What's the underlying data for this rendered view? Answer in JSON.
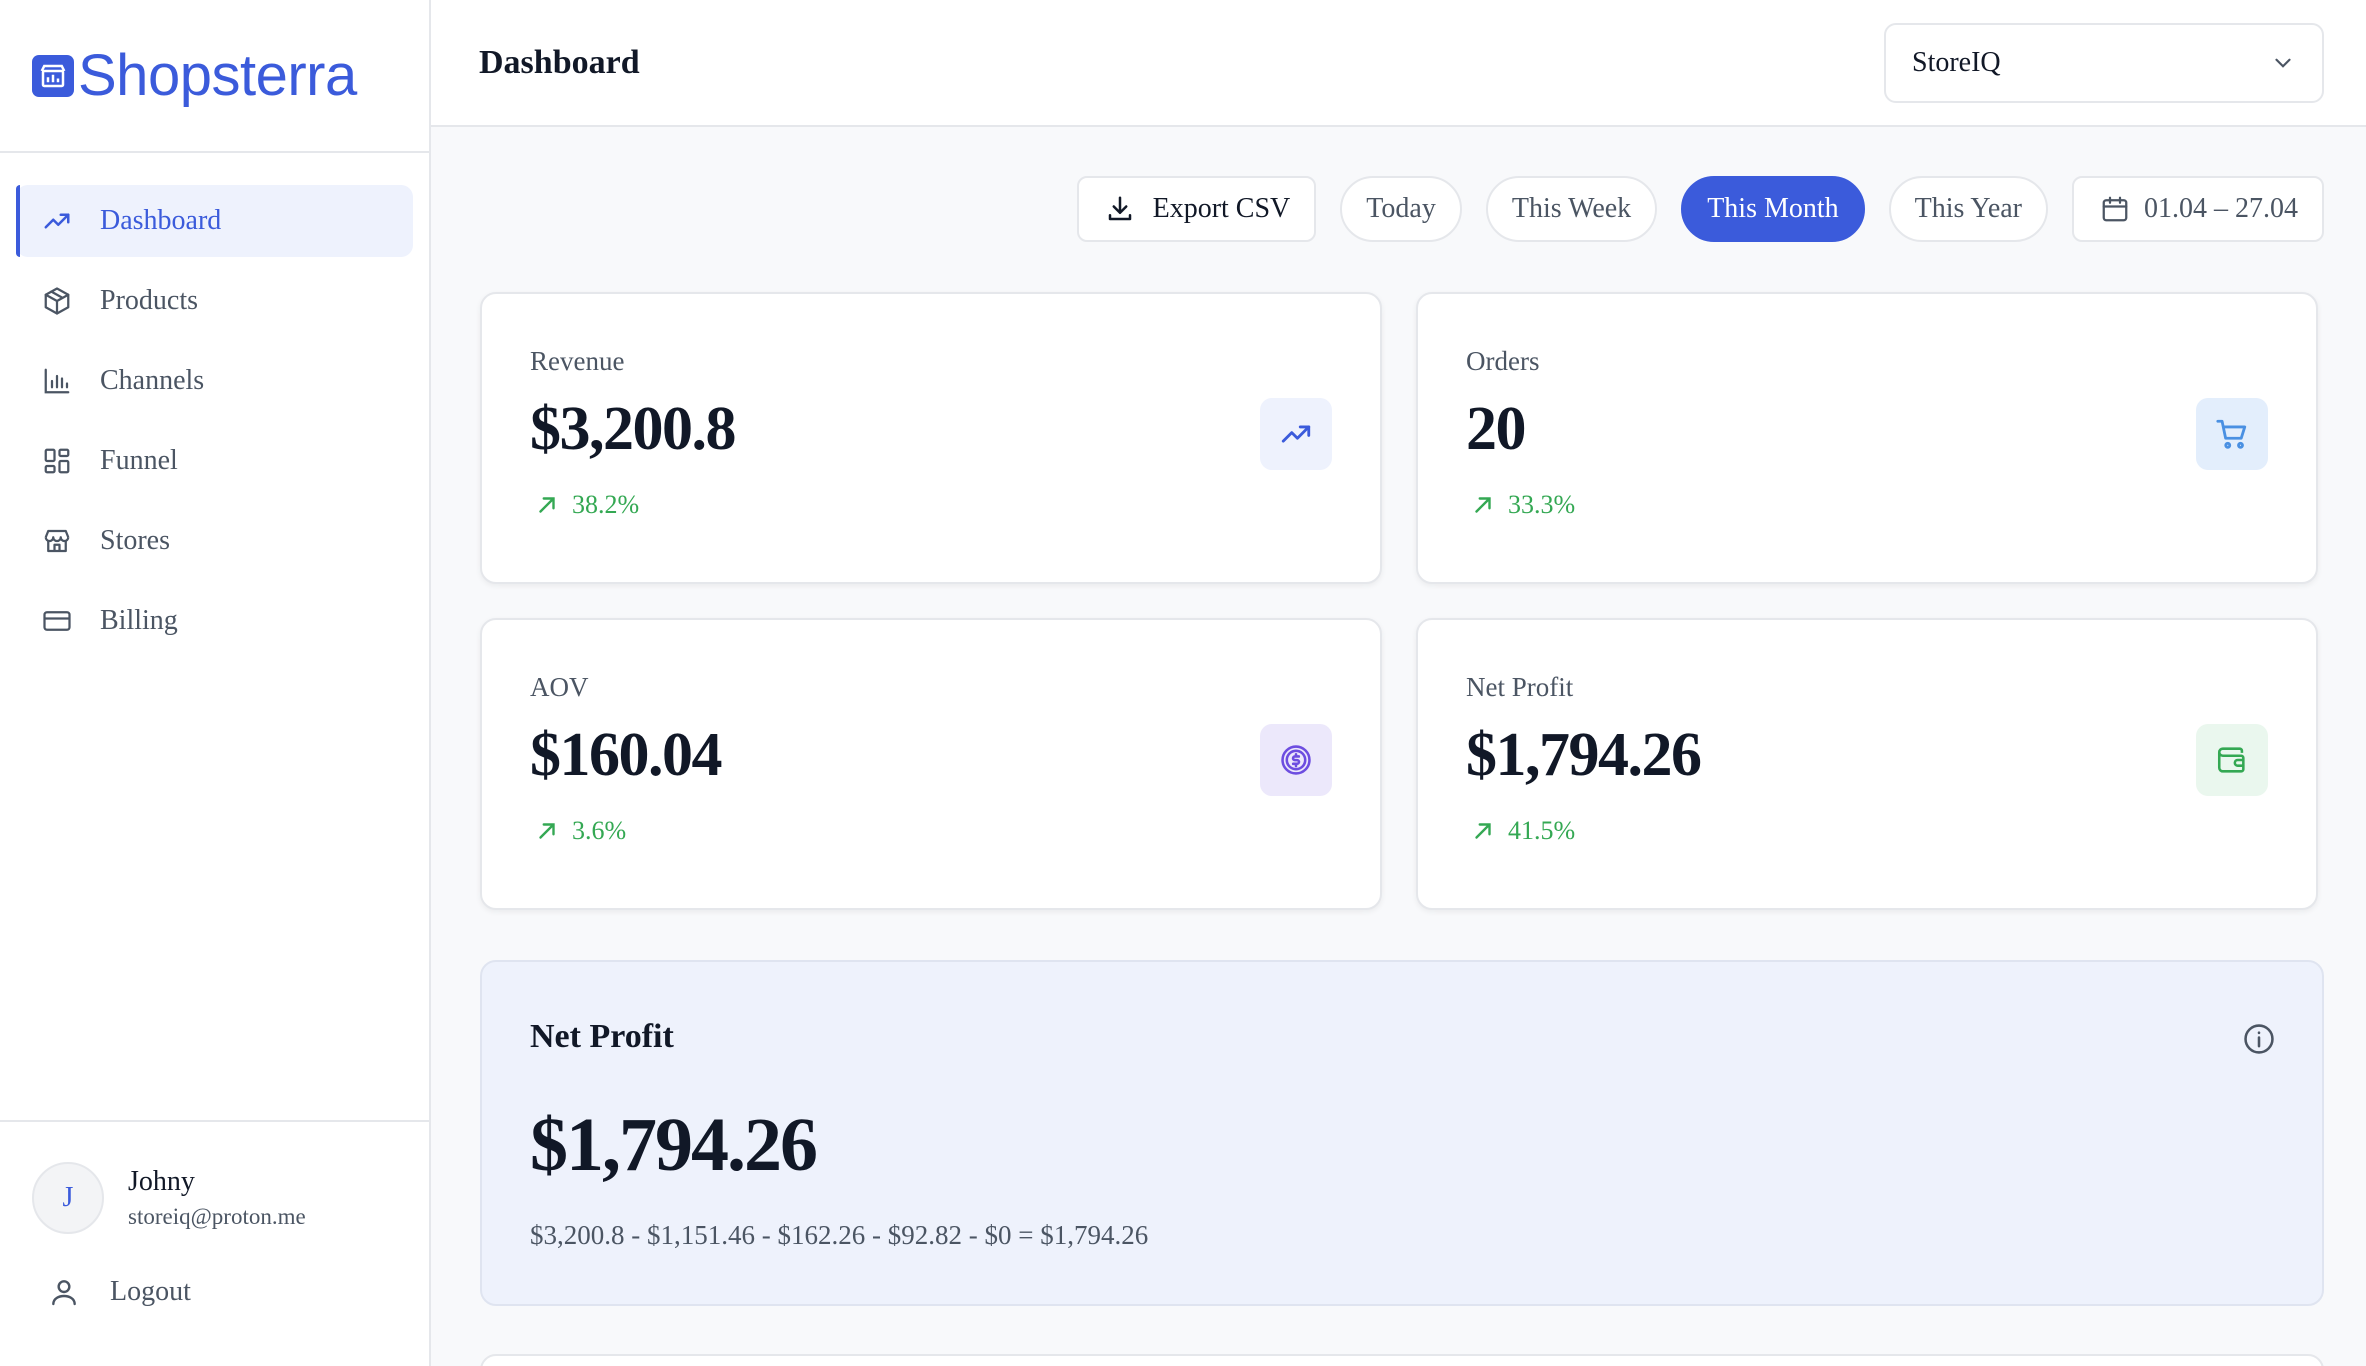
{
  "brand": {
    "name": "Shopsterra",
    "accent": "#3b5bdb"
  },
  "sidebar": {
    "items": [
      {
        "label": "Dashboard",
        "icon": "trending-up-icon",
        "active": true
      },
      {
        "label": "Products",
        "icon": "box-icon"
      },
      {
        "label": "Channels",
        "icon": "bar-chart-icon"
      },
      {
        "label": "Funnel",
        "icon": "layout-grid-icon"
      },
      {
        "label": "Stores",
        "icon": "store-icon"
      },
      {
        "label": "Billing",
        "icon": "credit-card-icon"
      }
    ],
    "user": {
      "initial": "J",
      "name": "Johny",
      "email": "storeiq@proton.me"
    },
    "logout_label": "Logout"
  },
  "header": {
    "title": "Dashboard",
    "store_select": {
      "value": "StoreIQ"
    }
  },
  "toolbar": {
    "export_label": "Export CSV",
    "periods": [
      {
        "label": "Today"
      },
      {
        "label": "This Week"
      },
      {
        "label": "This Month",
        "active": true
      },
      {
        "label": "This Year"
      }
    ],
    "date_range": "01.04 – 27.04"
  },
  "metrics": [
    {
      "label": "Revenue",
      "value": "$3,200.8",
      "change": "38.2%",
      "icon": "trending-up-icon",
      "icon_bg": "#eef2fd",
      "icon_color": "#3b5bdb"
    },
    {
      "label": "Orders",
      "value": "20",
      "change": "33.3%",
      "icon": "shopping-cart-icon",
      "icon_bg": "#e3eefc",
      "icon_color": "#4a90e2"
    },
    {
      "label": "AOV",
      "value": "$160.04",
      "change": "3.6%",
      "icon": "dollar-circle-icon",
      "icon_bg": "#ece8fb",
      "icon_color": "#6d4de0"
    },
    {
      "label": "Net Profit",
      "value": "$1,794.26",
      "change": "41.5%",
      "icon": "wallet-icon",
      "icon_bg": "#eaf7ee",
      "icon_color": "#34a853"
    }
  ],
  "net_profit_panel": {
    "title": "Net Profit",
    "value": "$1,794.26",
    "formula": "$3,200.8 - $1,151.46 - $162.26 - $92.82 - $0 = $1,794.26"
  }
}
